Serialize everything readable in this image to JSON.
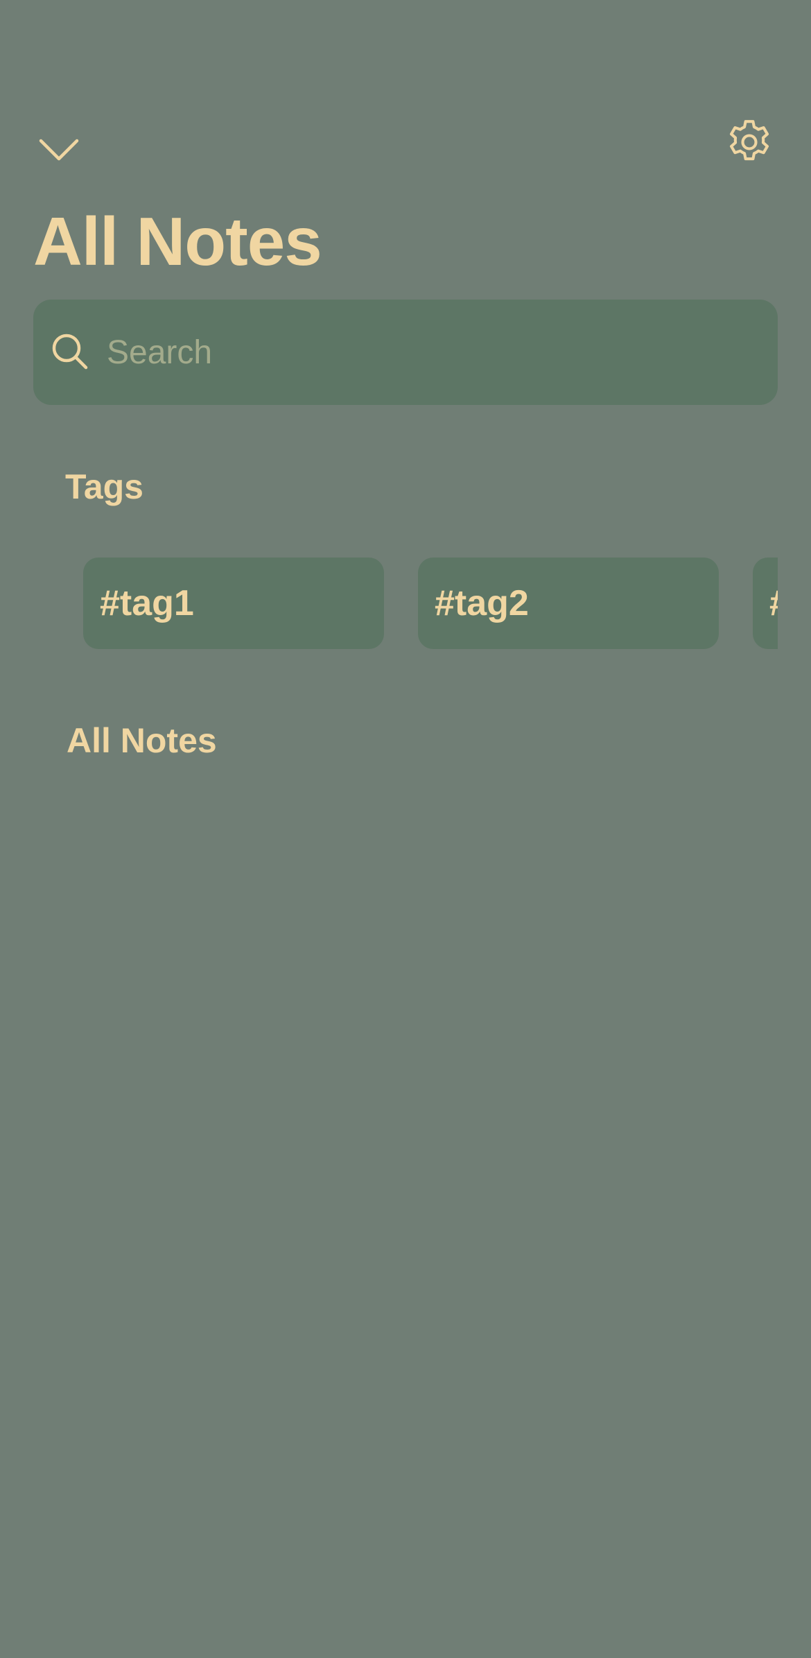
{
  "header": {
    "collapse_icon": "chevron-down-icon",
    "settings_icon": "gear-icon",
    "title": "All Notes"
  },
  "search": {
    "placeholder": "Search",
    "value": "",
    "icon": "search-icon"
  },
  "tags": {
    "heading": "Tags",
    "items": [
      {
        "label": "#tag1"
      },
      {
        "label": "#tag2"
      },
      {
        "label": "#"
      }
    ]
  },
  "notes": {
    "heading": "All Notes",
    "items": []
  },
  "colors": {
    "background": "#707e75",
    "surface": "#5d7665",
    "accent": "#f0d6a2",
    "placeholder": "#a3ab8c"
  }
}
